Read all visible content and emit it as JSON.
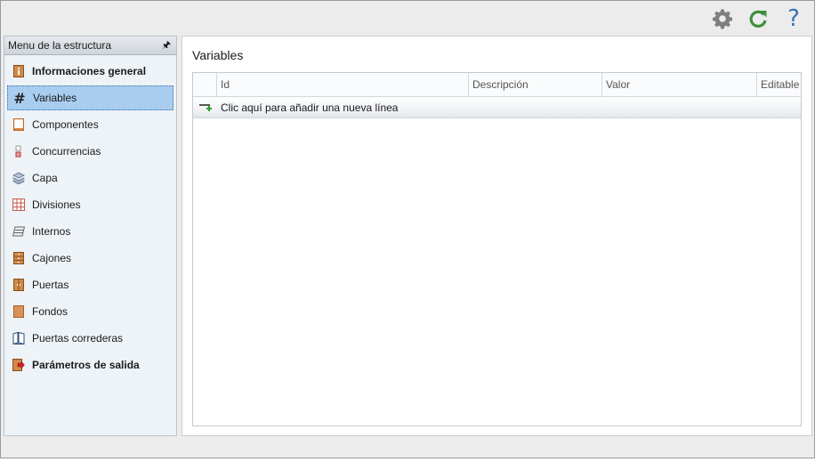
{
  "toolbar": {
    "icons": [
      "gear-icon",
      "refresh-icon",
      "help-icon"
    ],
    "help_glyph": "?",
    "colors": {
      "gear": "#7f7f7f",
      "refresh": "#3f8f3f",
      "help": "#3a6fb5"
    }
  },
  "sidebar": {
    "title": "Menu de la estructura",
    "pin_glyph": "🖈",
    "items": [
      {
        "label": "Informaciones general",
        "icon": "info-panel-icon",
        "bold": true
      },
      {
        "label": "Variables",
        "icon": "hash-icon",
        "selected": true
      },
      {
        "label": "Componentes",
        "icon": "component-icon"
      },
      {
        "label": "Concurrencias",
        "icon": "concurrency-icon"
      },
      {
        "label": "Capa",
        "icon": "layers-icon"
      },
      {
        "label": "Divisiones",
        "icon": "grid-divisions-icon"
      },
      {
        "label": "Internos",
        "icon": "internal-shelf-icon"
      },
      {
        "label": "Cajones",
        "icon": "drawers-icon"
      },
      {
        "label": "Puertas",
        "icon": "door-icon"
      },
      {
        "label": "Fondos",
        "icon": "back-panel-icon"
      },
      {
        "label": "Puertas correderas",
        "icon": "sliding-door-icon"
      },
      {
        "label": "Parámetros de salida",
        "icon": "output-params-icon",
        "bold": true
      }
    ],
    "hash_glyph": "#",
    "selection_color": "#a9cdef"
  },
  "main": {
    "title": "Variables",
    "grid": {
      "columns": [
        "Id",
        "Descripción",
        "Valor",
        "Editable"
      ],
      "new_row_text": "Clic aquí para añadir una nueva línea"
    }
  }
}
